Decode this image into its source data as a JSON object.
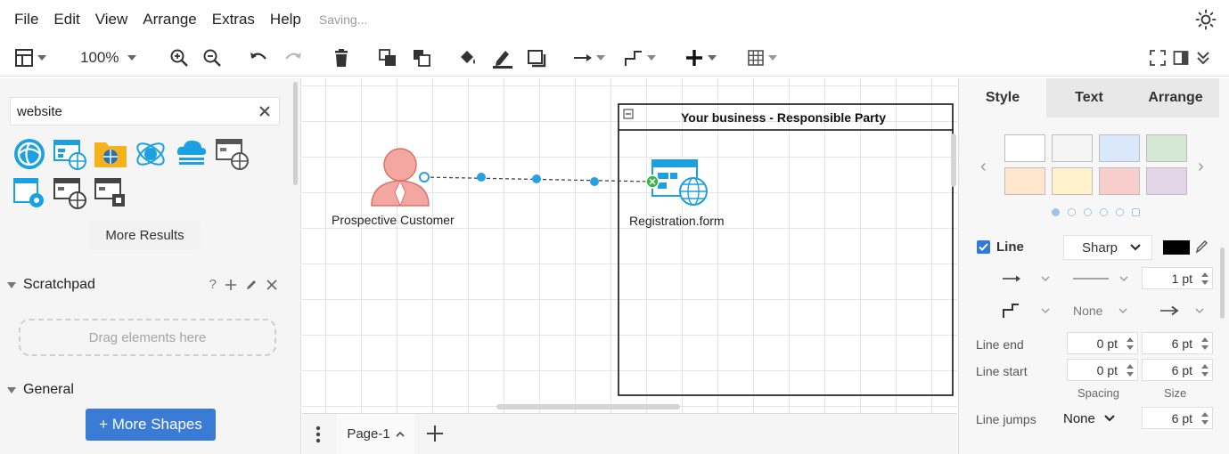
{
  "menu": {
    "items": [
      "File",
      "Edit",
      "View",
      "Arrange",
      "Extras",
      "Help"
    ],
    "status": "Saving..."
  },
  "toolbar": {
    "zoom": "100%"
  },
  "sidebar": {
    "search": {
      "value": "website"
    },
    "more_results": "More Results",
    "scratchpad": {
      "title": "Scratchpad",
      "help": "?",
      "drop_hint": "Drag elements here"
    },
    "general": {
      "title": "General"
    },
    "more_shapes": "+ More Shapes"
  },
  "canvas": {
    "container_title": "Your business - Responsible Party",
    "actor_label": "Prospective Customer",
    "form_label": "Registration.form"
  },
  "pages": {
    "current": "Page-1"
  },
  "format_panel": {
    "tabs": {
      "style": "Style",
      "text": "Text",
      "arrange": "Arrange"
    },
    "swatch_colors": [
      "#ffffff",
      "#f5f5f5",
      "#dae8fc",
      "#d5e8d4",
      "#ffe6cc",
      "#fff2cc",
      "#f8cecc",
      "#e1d5e7"
    ],
    "line": {
      "label": "Line",
      "checked": true,
      "style": "Sharp",
      "color": "#000000",
      "width": "1 pt",
      "waypoints": "None"
    },
    "line_end": {
      "label": "Line end",
      "spacing": "0 pt",
      "size": "6 pt"
    },
    "line_start": {
      "label": "Line start",
      "spacing": "0 pt",
      "size": "6 pt"
    },
    "col_spacing": "Spacing",
    "col_size": "Size",
    "line_jumps": {
      "label": "Line jumps",
      "value": "None",
      "size": "6 pt"
    }
  }
}
